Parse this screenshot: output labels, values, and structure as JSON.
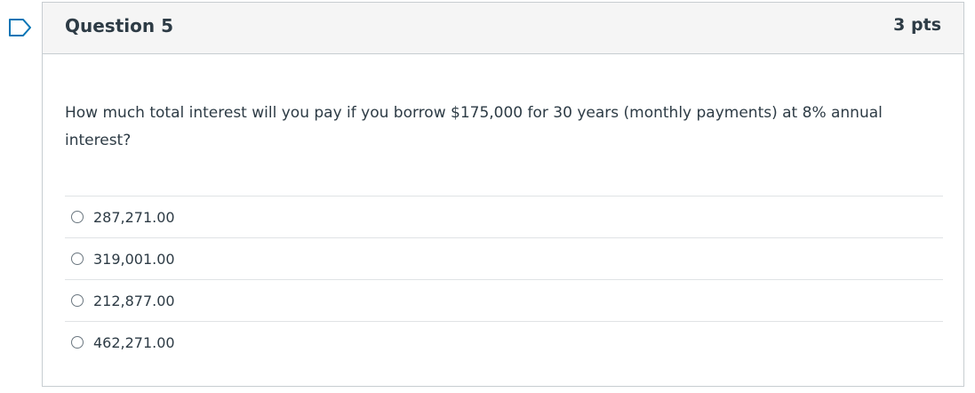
{
  "question": {
    "title": "Question 5",
    "points": "3 pts",
    "text": "How much total interest will you pay if you borrow $175,000 for 30 years (monthly payments) at 8% annual interest?",
    "flag_icon": "bookmark-flag-icon"
  },
  "answers": [
    {
      "label": "287,271.00"
    },
    {
      "label": "319,001.00"
    },
    {
      "label": "212,877.00"
    },
    {
      "label": "462,271.00"
    }
  ],
  "colors": {
    "accent": "#0374b5",
    "text": "#2d3b45",
    "header_bg": "#f5f5f5",
    "border": "#c7cdd1"
  }
}
